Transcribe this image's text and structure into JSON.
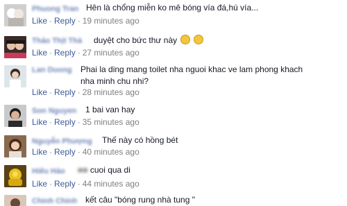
{
  "comments": [
    {
      "name": "Phuong Tran",
      "text": "Hên là chổng miễn ko mê bóng vía đá,hú vía...",
      "like": "Like",
      "reply": "Reply",
      "time": "19 minutes ago"
    },
    {
      "name": "Thảo Thịt Thà",
      "text": "duyệt cho bức thư này",
      "like": "Like",
      "reply": "Reply",
      "time": "27 minutes ago",
      "emoji_icons": [
        "smiley-icon",
        "smiley-icon"
      ]
    },
    {
      "name": "Lan Duong",
      "text": "Phai la ding mang toilet nha nguoi khac ve lam phong khach nha minh chu nhi?",
      "like": "Like",
      "reply": "Reply",
      "time": "28 minutes ago"
    },
    {
      "name": "Son Nguyen",
      "text": "1 bai van hay",
      "like": "Like",
      "reply": "Reply",
      "time": "35 minutes ago"
    },
    {
      "name": "Nguyễn Phượng",
      "text": "Thế này có hồng bét",
      "like": "Like",
      "reply": "Reply",
      "time": "40 minutes ago"
    },
    {
      "name": "Hiếu Hảo",
      "text": "cuoi qua di",
      "like": "Like",
      "reply": "Reply",
      "time": "44 minutes ago"
    },
    {
      "name": "Chinh Chinh",
      "text": "kết câu \"bóng rung nhà tung \""
    }
  ],
  "colors": {
    "link": "#3b5998",
    "name": "#6f86b8",
    "meta": "#7f7f7f",
    "text": "#141823"
  }
}
